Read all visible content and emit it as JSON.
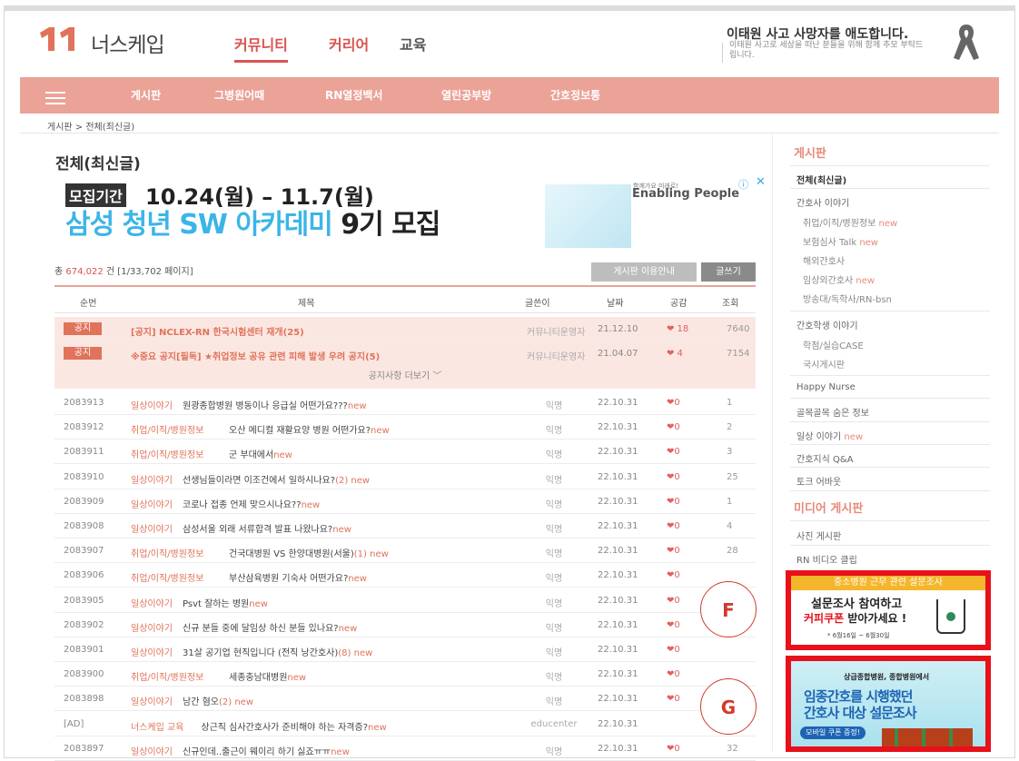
{
  "header": {
    "logo_text": "너스케입",
    "nav": [
      "커뮤니티",
      "커리어",
      "교육"
    ],
    "memorial_title": "이태원 사고 사망자를 애도합니다.",
    "memorial_sub": "이태원 사고로 세상을 떠난 분들을 위해 함께 추모 부탁드립니다."
  },
  "navbar": [
    "게시판",
    "그병원어때",
    "RN열정백서",
    "열린공부방",
    "간호정보통"
  ],
  "breadcrumb": "게시판 > 전체(최신글)",
  "page_title": "전체(최신글)",
  "ad": {
    "tag": "모집기간",
    "dates": "10.24(월) – 11.7(월)",
    "headline_a": "삼성 청년 SW 아카데미",
    "headline_b": " 9기 모집",
    "small": "함께가요 미래로!",
    "brand": "Enabling People",
    "info": "ⓘ",
    "close": "✕"
  },
  "count_prefix": "총 ",
  "count_value": "674,022",
  "count_suffix": " 건 [1/33,702 페이지]",
  "buttons": {
    "guide": "게시판 이용안내",
    "write": "글쓰기"
  },
  "columns": [
    "순번",
    "제목",
    "글쓴이",
    "날짜",
    "공감",
    "조회"
  ],
  "notices": [
    {
      "badge": "공지",
      "title": "[공지] NCLEX-RN 한국시험센터 재개",
      "count": "(25)",
      "author": "커뮤니티운영자",
      "date": "21.12.10",
      "likes": "❤ 18",
      "views": "7640"
    },
    {
      "badge": "공지",
      "title": "※중요 공지[필독] ★취업정보 공유 관련 피해 발생 우려 공지",
      "count": "(5)",
      "author": "커뮤니티운영자",
      "date": "21.04.07",
      "likes": "❤ 4",
      "views": "7154"
    }
  ],
  "more_notices": "공지사항 더보기 ﹀",
  "posts": [
    {
      "num": "2083913",
      "cat": "일상이야기",
      "title": "원광종합병원 병동이나 응급실 어떤가요???",
      "count": "",
      "new": "new",
      "author": "익명",
      "date": "22.10.31",
      "likes": "❤0",
      "views": "1"
    },
    {
      "num": "2083912",
      "cat": "취업/이직/병원정보",
      "title": "오산 메디컬 재활요양 병원 어떤가요?",
      "count": "",
      "new": "new",
      "author": "익명",
      "date": "22.10.31",
      "likes": "❤0",
      "views": "2"
    },
    {
      "num": "2083911",
      "cat": "취업/이직/병원정보",
      "title": "군 부대에서",
      "count": "",
      "new": "new",
      "author": "익명",
      "date": "22.10.31",
      "likes": "❤0",
      "views": "3"
    },
    {
      "num": "2083910",
      "cat": "일상이야기",
      "title": "선생님들이라면 이조건에서 일하시나요?",
      "count": "(2)",
      "new": " new",
      "author": "익명",
      "date": "22.10.31",
      "likes": "❤0",
      "views": "25"
    },
    {
      "num": "2083909",
      "cat": "일상이야기",
      "title": "코로나 접종 언제 맞으시나요??",
      "count": "",
      "new": "new",
      "author": "익명",
      "date": "22.10.31",
      "likes": "❤0",
      "views": "1"
    },
    {
      "num": "2083908",
      "cat": "일상이야기",
      "title": "삼성서울 외래 서류합격 발표 나왔나요?",
      "count": "",
      "new": "new",
      "author": "익명",
      "date": "22.10.31",
      "likes": "❤0",
      "views": "4"
    },
    {
      "num": "2083907",
      "cat": "취업/이직/병원정보",
      "title": "건국대병원 VS 한양대병원(서울)",
      "count": "(1)",
      "new": " new",
      "author": "익명",
      "date": "22.10.31",
      "likes": "❤0",
      "views": "28"
    },
    {
      "num": "2083906",
      "cat": "취업/이직/병원정보",
      "title": "부산삼육병원 기숙사 어떤가요?",
      "count": "",
      "new": "new",
      "author": "익명",
      "date": "22.10.31",
      "likes": "❤0",
      "views": ""
    },
    {
      "num": "2083905",
      "cat": "일상이야기",
      "title": "Psvt 잘하는 병원",
      "count": "",
      "new": "new",
      "author": "익명",
      "date": "22.10.31",
      "likes": "❤0",
      "views": ""
    },
    {
      "num": "2083902",
      "cat": "일상이야기",
      "title": "신규 분들 중에 달임상 하신 분들 있나요?",
      "count": "",
      "new": "new",
      "author": "익명",
      "date": "22.10.31",
      "likes": "❤0",
      "views": ""
    },
    {
      "num": "2083901",
      "cat": "일상이야기",
      "title": "31살 공기업 현직입니다 (전직 낭간호사)",
      "count": "(8)",
      "new": " new",
      "author": "익명",
      "date": "22.10.31",
      "likes": "❤0",
      "views": ""
    },
    {
      "num": "2083900",
      "cat": "취업/이직/병원정보",
      "title": "세종충남대병원",
      "count": "",
      "new": "new",
      "author": "익명",
      "date": "22.10.31",
      "likes": "❤0",
      "views": ""
    },
    {
      "num": "2083898",
      "cat": "일상이야기",
      "title": "남간 혐오",
      "count": "(2)",
      "new": " new",
      "author": "익명",
      "date": "22.10.31",
      "likes": "❤0",
      "views": ""
    },
    {
      "num": "[AD]",
      "cat": "너스케입 교육",
      "title": "상근직 심사간호사가 준비해야 하는 자격증?",
      "count": "",
      "new": "new",
      "author": "educenter",
      "date": "22.10.31",
      "likes": "",
      "views": ""
    },
    {
      "num": "2083897",
      "cat": "일상이야기",
      "title": "신규인데..출근이 웨이리 하기 싫죠ㅠㅠ",
      "count": "",
      "new": "new",
      "author": "익명",
      "date": "22.10.31",
      "likes": "❤0",
      "views": "32"
    }
  ],
  "sidebar": {
    "board_head": "게시판",
    "all": "전체(최신글)",
    "nurse_story": "간호사 이야기",
    "nurse_subs": [
      {
        "label": "취업/이직/병원정보",
        "new": " new"
      },
      {
        "label": "보험심사 Talk",
        "new": " new"
      },
      {
        "label": "해외간호사",
        "new": ""
      },
      {
        "label": "임상외간호사",
        "new": " new"
      },
      {
        "label": "방송대/독학사/RN-bsn",
        "new": ""
      }
    ],
    "student_story": "간호학생 이야기",
    "student_subs": [
      "학점/실습CASE",
      "국시게시판"
    ],
    "happy": "Happy Nurse",
    "info": "골목골목 숨은 정보",
    "daily": "일상 이야기",
    "daily_new": " new",
    "qa": "간호지식 Q&A",
    "talk": "토크 어바웃",
    "media_head": "미디어 게시판",
    "photo": "사진 게시판",
    "video": "RN 비디오 클립"
  },
  "ad_f": {
    "band": "중소병원 근무 관련 설문조사",
    "line1": "설문조사 참여하고",
    "line2_red": "커피쿠폰",
    "line2_rest": " 받아가세요 !",
    "date": "* 6월16일 ~ 6월30일",
    "label": "F"
  },
  "ad_g": {
    "head": "상급종합병원, 종합병원에서",
    "line1": "임종간호를 시행했던",
    "line2": "간호사 대상 설문조사",
    "btn": "모바일 쿠폰 증정!",
    "label": "G"
  }
}
